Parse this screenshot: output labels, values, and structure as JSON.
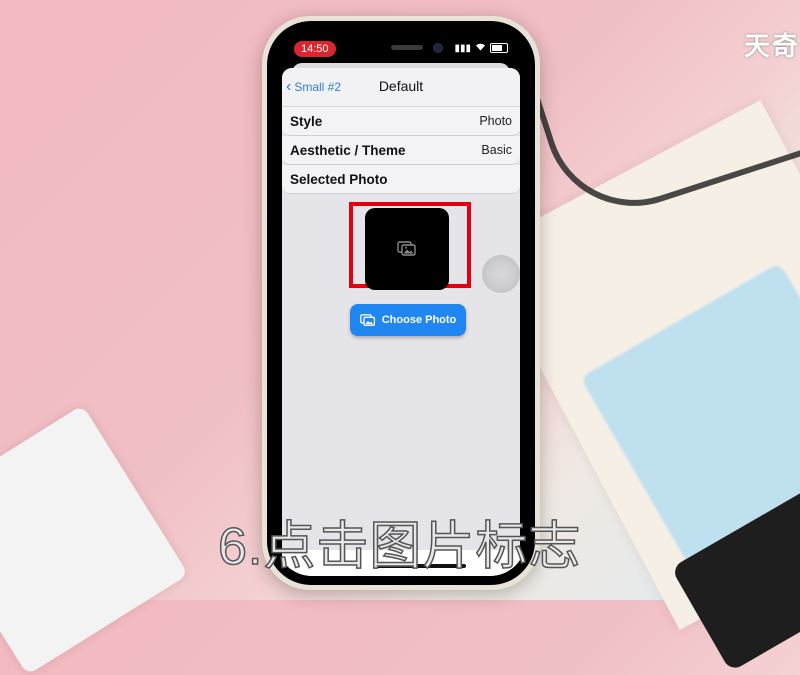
{
  "watermark": "天奇",
  "caption": "6.点击图片标志",
  "status_bar": {
    "time": "14:50",
    "signal": "signal-icon",
    "wifi": "wifi-icon",
    "battery": "battery-icon"
  },
  "navbar": {
    "back_label": "Small #2",
    "title": "Default"
  },
  "rows": [
    {
      "label": "Style",
      "value": "Photo"
    },
    {
      "label": "Aesthetic / Theme",
      "value": "Basic"
    },
    {
      "label": "Selected Photo",
      "value": ""
    }
  ],
  "photo": {
    "icon": "photo-stack-icon"
  },
  "choose_button": {
    "label": "Choose Photo"
  },
  "colors": {
    "accent": "#1f86f2",
    "highlight": "#e00010",
    "time_pill": "#d8262f"
  }
}
